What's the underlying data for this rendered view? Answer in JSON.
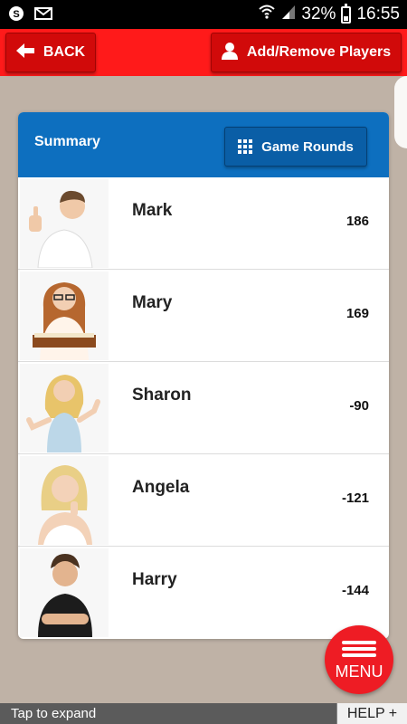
{
  "status_bar": {
    "icons": [
      "skype-icon",
      "email-icon",
      "wifi-icon",
      "signal-icon",
      "battery-icon"
    ],
    "battery": "32%",
    "time": "16:55"
  },
  "top_bar": {
    "back_label": "BACK",
    "add_remove_label": "Add/Remove Players"
  },
  "summary": {
    "title": "Summary",
    "game_rounds_label": "Game Rounds"
  },
  "players": [
    {
      "name": "Mark",
      "score": "186"
    },
    {
      "name": "Mary",
      "score": "169"
    },
    {
      "name": "Sharon",
      "score": "-90"
    },
    {
      "name": "Angela",
      "score": "-121"
    },
    {
      "name": "Harry",
      "score": "-144"
    }
  ],
  "menu_label": "MENU",
  "bottom": {
    "tap_text": "Tap to expand",
    "help_label": "HELP +"
  },
  "colors": {
    "top_bar": "#ff1a1a",
    "summary_header": "#0d6fbf",
    "background": "#bfb2a6",
    "menu_button": "#ee1c24"
  }
}
